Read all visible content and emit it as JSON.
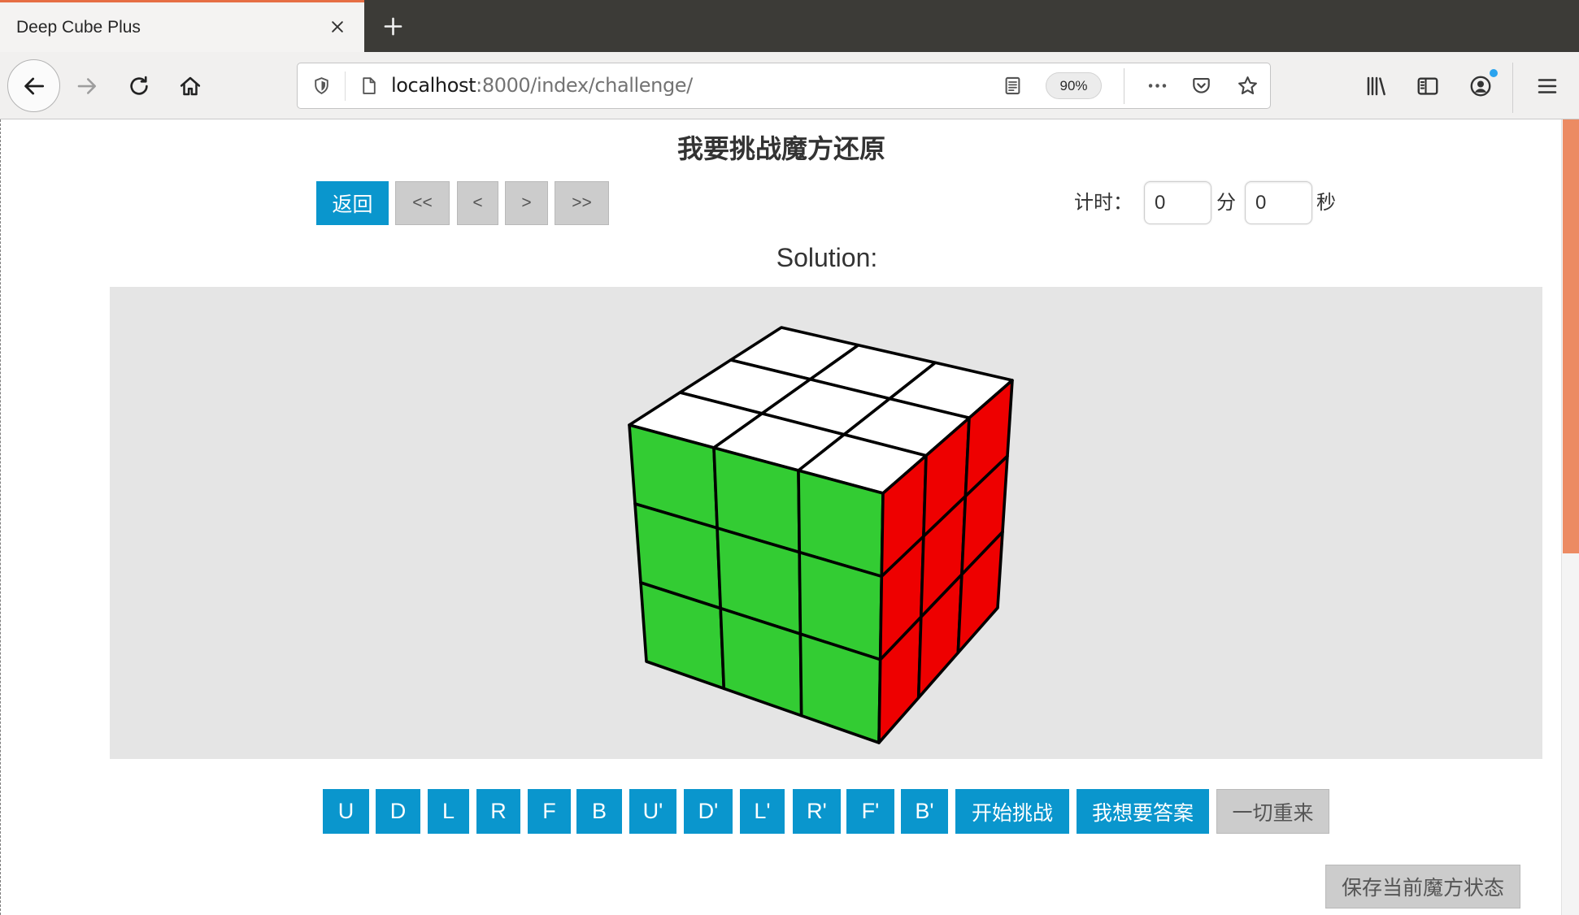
{
  "browser": {
    "tab_title": "Deep Cube Plus",
    "url_host": "localhost",
    "url_path": ":8000/index/challenge/",
    "zoom": "90%",
    "account_notification": true
  },
  "icons": {
    "tab": [
      "close-tab-icon",
      "new-tab-icon"
    ],
    "toolbar": [
      "back-arrow-icon",
      "forward-arrow-icon",
      "reload-icon",
      "home-icon"
    ],
    "urlbar": [
      "shield-icon",
      "page-icon",
      "reader-view-icon",
      "more-dots-icon",
      "pocket-icon",
      "star-icon"
    ],
    "right": [
      "library-icon",
      "sidebar-icon",
      "account-icon",
      "hamburger-menu-icon"
    ]
  },
  "theme": {
    "accent": "#0a96cd",
    "button_gray": "#cccccc",
    "canvas_background": "#e5e5e5",
    "scrollbar_thumb": "#ec8b63",
    "tab_stripe": "#e66e44"
  },
  "page": {
    "title": "我要挑战魔方还原",
    "nav": {
      "back": "返回",
      "first": "<<",
      "prev": "<",
      "next": ">",
      "last": ">>"
    },
    "timer": {
      "label": "计时：",
      "minutes": "0",
      "minutes_unit": "分",
      "seconds": "0",
      "seconds_unit": "秒"
    },
    "solution_label": "Solution:",
    "moves": [
      "U",
      "D",
      "L",
      "R",
      "F",
      "B",
      "U'",
      "D'",
      "L'",
      "R'",
      "F'",
      "B'"
    ],
    "actions": {
      "start_challenge": "开始挑战",
      "show_answer": "我想要答案",
      "reset_all": "一切重来"
    },
    "save_state": "保存当前魔方状态"
  },
  "cube": {
    "top": [
      "#ffffff",
      "#ffffff",
      "#ffffff",
      "#ffffff",
      "#ffffff",
      "#ffffff",
      "#ffffff",
      "#ffffff",
      "#ffffff"
    ],
    "front": [
      "#33cc33",
      "#33cc33",
      "#33cc33",
      "#33cc33",
      "#33cc33",
      "#33cc33",
      "#33cc33",
      "#33cc33",
      "#33cc33"
    ],
    "right": [
      "#ee0000",
      "#ee0000",
      "#ee0000",
      "#ee0000",
      "#ee0000",
      "#ee0000",
      "#ee0000",
      "#ee0000",
      "#ee0000"
    ]
  }
}
